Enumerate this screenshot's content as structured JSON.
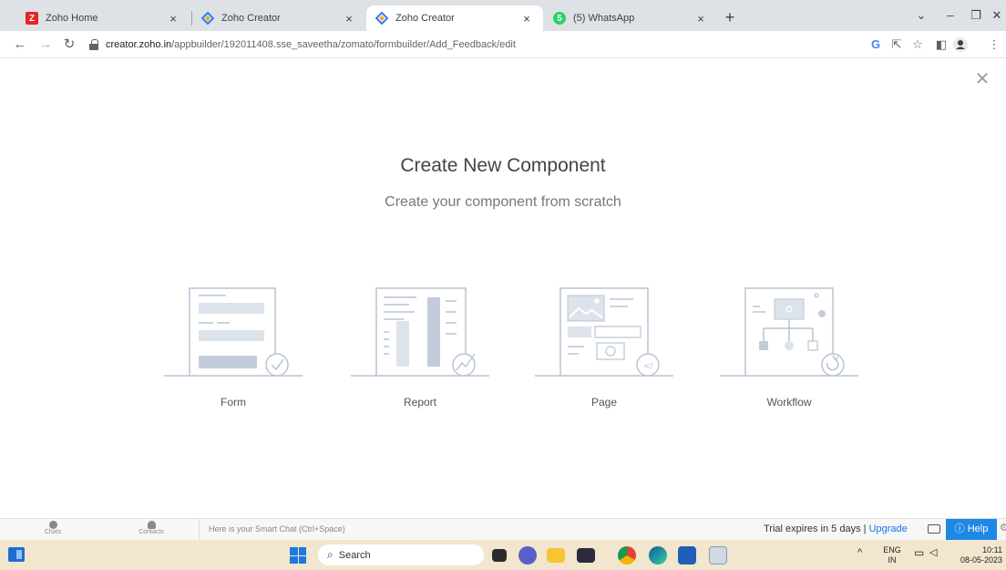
{
  "browser": {
    "tabs": [
      {
        "title": "Zoho Home",
        "favicon": "zoho-z-icon",
        "favicon_color": "#e42527"
      },
      {
        "title": "Zoho Creator",
        "favicon": "zoho-creator-icon",
        "favicon_color": "#ffffff"
      },
      {
        "title": "Zoho Creator",
        "favicon": "zoho-creator-icon",
        "favicon_color": "#ffffff"
      },
      {
        "title": "(5) WhatsApp",
        "favicon": "whatsapp-icon",
        "favicon_color": "#25d366"
      }
    ],
    "active_tab_index": 2,
    "url_host": "creator.zoho.in",
    "url_path": "/appbuilder/192011408.sse_saveetha/zomato/formbuilder/Add_Feedback/edit",
    "profile_initial": "G"
  },
  "page": {
    "title": "Create New Component",
    "subtitle": "Create your component from scratch",
    "components": [
      {
        "label": "Form",
        "icon": "form-illustration-icon"
      },
      {
        "label": "Report",
        "icon": "report-illustration-icon"
      },
      {
        "label": "Page",
        "icon": "page-illustration-icon"
      },
      {
        "label": "Workflow",
        "icon": "workflow-illustration-icon"
      }
    ]
  },
  "zoho_bar": {
    "chats_label": "Chats",
    "contacts_label": "Contacts",
    "chat_placeholder": "Here is your Smart Chat (Ctrl+Space)",
    "trial_text": "Trial expires in 5 days |",
    "upgrade_label": "Upgrade",
    "help_label": "Help"
  },
  "taskbar": {
    "search_label": "Search",
    "language": "ENG",
    "region": "IN",
    "time": "10:11",
    "date": "08-05-2023"
  },
  "colors": {
    "accent_blue": "#1e88e5",
    "illustration_line": "#b9c4d3",
    "illustration_fill": "#dde3eb",
    "taskbar_bg": "#f2e6cf"
  }
}
